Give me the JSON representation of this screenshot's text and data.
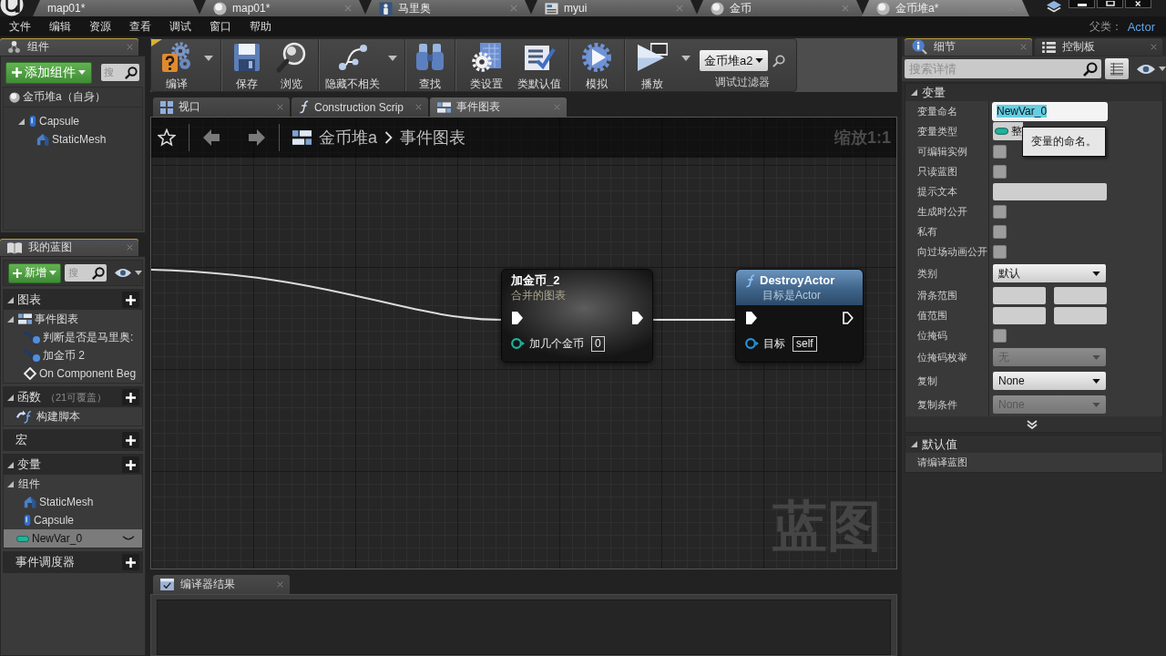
{
  "title_bar": {
    "tabs": [
      {
        "label": "map01*",
        "kind": "none",
        "selected": false,
        "closable": false
      },
      {
        "label": "map01*",
        "kind": "sphere",
        "selected": false,
        "closable": true
      },
      {
        "label": "马里奥",
        "kind": "character",
        "selected": false,
        "closable": true
      },
      {
        "label": "myui",
        "kind": "widget",
        "selected": false,
        "closable": true
      },
      {
        "label": "金币",
        "kind": "sphere",
        "selected": false,
        "closable": true
      },
      {
        "label": "金币堆a*",
        "kind": "sphere",
        "selected": true,
        "closable": true
      }
    ]
  },
  "menu": {
    "items": [
      "文件",
      "编辑",
      "资源",
      "查看",
      "调试",
      "窗口",
      "帮助"
    ],
    "parent_class_label": "父类：",
    "parent_class": "Actor"
  },
  "components_panel": {
    "tab": "组件",
    "add_button": "添加组件",
    "search": {
      "placeholder": "搜"
    },
    "tree": [
      {
        "label": "金币堆a（自身）",
        "kind": "sphere",
        "selected": false,
        "children": [
          {
            "label": "Capsule",
            "kind": "capsule",
            "selected": false,
            "expanded": true,
            "children": [
              {
                "label": "StaticMesh",
                "kind": "mesh",
                "selected": false
              }
            ]
          }
        ]
      }
    ]
  },
  "my_blueprint": {
    "tab": "我的蓝图",
    "new_button": "新增",
    "search": {
      "placeholder": "搜"
    },
    "sections": [
      {
        "title": "图表",
        "expanded": true,
        "items": [
          {
            "label": "事件图表",
            "kind": "graph",
            "selected": false,
            "expanded": true,
            "children": [
              {
                "label": "判断是否是马里奥:",
                "kind": "event",
                "selected": false
              },
              {
                "label": "加金币 2",
                "kind": "event",
                "selected": false
              },
              {
                "label": "On Component Beg",
                "kind": "bound_event",
                "selected": false
              }
            ]
          }
        ]
      },
      {
        "title": "函数",
        "note": "（21可覆盖）",
        "expanded": true,
        "items": [
          {
            "label": "构建脚本",
            "kind": "function",
            "selected": false
          }
        ]
      },
      {
        "title": "宏"
      },
      {
        "title": "变量",
        "expanded": true,
        "items": [
          {
            "label": "组件",
            "kind": "category",
            "selected": false,
            "expanded": true,
            "children": [
              {
                "label": "StaticMesh",
                "kind": "mesh",
                "selected": false
              },
              {
                "label": "Capsule",
                "kind": "capsule",
                "selected": false
              }
            ]
          },
          {
            "label": "NewVar_0",
            "kind": "variable",
            "selected": true
          }
        ]
      },
      {
        "title": "事件调度器"
      }
    ]
  },
  "toolbar": {
    "groups": [
      {
        "buttons": [
          {
            "label": "编译",
            "kind": "compile",
            "dropdown": true
          }
        ]
      },
      {
        "buttons": [
          {
            "label": "保存",
            "kind": "save",
            "dropdown": false
          },
          {
            "label": "浏览",
            "kind": "browse",
            "dropdown": false
          }
        ]
      },
      {
        "buttons": [
          {
            "label": "隐藏不相关",
            "kind": "hide_unrelated",
            "dropdown": true
          }
        ]
      },
      {
        "buttons": [
          {
            "label": "查找",
            "kind": "find",
            "dropdown": false
          }
        ]
      },
      {
        "buttons": [
          {
            "label": "类设置",
            "kind": "class_settings",
            "dropdown": false
          },
          {
            "label": "类默认值",
            "kind": "class_defaults",
            "dropdown": false
          }
        ]
      },
      {
        "buttons": [
          {
            "label": "模拟",
            "kind": "simulate",
            "dropdown": false
          }
        ]
      },
      {
        "buttons": [
          {
            "label": "播放",
            "kind": "play",
            "dropdown": true
          }
        ]
      }
    ],
    "debug_filter": {
      "value": "金币堆a2",
      "label": "调试过滤器"
    }
  },
  "graph_tabs": [
    {
      "label": "视口",
      "kind": "viewport",
      "selected": false
    },
    {
      "label": "Construction Scrip",
      "kind": "function",
      "selected": false
    },
    {
      "label": "事件图表",
      "kind": "graph",
      "selected": true
    }
  ],
  "graph": {
    "breadcrumb": [
      "金币堆a",
      "事件图表"
    ],
    "zoom": "缩放1:1",
    "watermark": "蓝图",
    "nodes": [
      {
        "kind": "collapsed",
        "title": "加金币_2",
        "subtitle": "合并的图表",
        "exec_in_linked": true,
        "exec_out_linked": true,
        "pins": [
          {
            "label": "加几个金币",
            "value": "0",
            "color": "#1fb39b"
          }
        ]
      },
      {
        "kind": "function",
        "title": "DestroyActor",
        "subtitle": "目标是Actor",
        "exec_in_linked": true,
        "exec_out_linked": false,
        "pins": [
          {
            "label": "目标",
            "value": "self",
            "color": "#2d8fd5"
          }
        ]
      }
    ]
  },
  "compiler_results": {
    "tab": "编译器结果"
  },
  "details": {
    "tabs": [
      {
        "label": "细节",
        "kind": "details",
        "selected": true
      },
      {
        "label": "控制板",
        "kind": "palette",
        "selected": false
      }
    ],
    "search": {
      "placeholder": "搜索详情"
    },
    "sections": [
      {
        "title": "变量",
        "expanded": true,
        "advanced": true,
        "rows": [
          {
            "label": "变量命名",
            "kind": "text",
            "value": "NewVar_0",
            "focused": true
          },
          {
            "label": "变量类型",
            "kind": "type",
            "value": "整"
          },
          {
            "label": "可编辑实例",
            "kind": "checkbox",
            "checked": false
          },
          {
            "label": "只读蓝图",
            "kind": "checkbox",
            "checked": false
          },
          {
            "label": "提示文本",
            "kind": "text",
            "focused": false
          },
          {
            "label": "生成时公开",
            "kind": "checkbox",
            "checked": false
          },
          {
            "label": "私有",
            "kind": "checkbox",
            "checked": false
          },
          {
            "label": "向过场动画公开",
            "kind": "checkbox",
            "checked": false
          },
          {
            "label": "类别",
            "kind": "dropdown",
            "value": "默认",
            "disabled": false
          },
          {
            "label": "滑条范围",
            "kind": "range"
          },
          {
            "label": "值范围",
            "kind": "range"
          },
          {
            "label": "位掩码",
            "kind": "checkbox",
            "checked": false
          },
          {
            "label": "位掩码枚举",
            "kind": "dropdown",
            "value": "无",
            "disabled": true
          },
          {
            "label": "复制",
            "kind": "dropdown",
            "value": "None",
            "disabled": false
          },
          {
            "label": "复制条件",
            "kind": "dropdown",
            "value": "None",
            "disabled": true
          }
        ]
      },
      {
        "title": "默认值",
        "expanded": true,
        "rows": [
          {
            "label": "请编译蓝图",
            "kind": "message"
          }
        ]
      }
    ],
    "tooltip": "变量的命名。"
  }
}
